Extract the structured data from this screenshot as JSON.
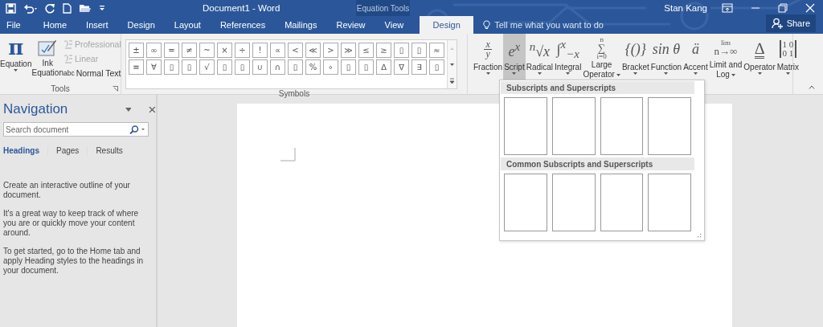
{
  "window": {
    "title": "Document1 - Word",
    "user": "Stan Kang"
  },
  "contextual_tab": {
    "label": "Equation Tools"
  },
  "tabs": [
    {
      "label": "File",
      "selected": false
    },
    {
      "label": "Home",
      "selected": false
    },
    {
      "label": "Insert",
      "selected": false
    },
    {
      "label": "Design",
      "selected": false
    },
    {
      "label": "Layout",
      "selected": false
    },
    {
      "label": "References",
      "selected": false
    },
    {
      "label": "Mailings",
      "selected": false
    },
    {
      "label": "Review",
      "selected": false
    },
    {
      "label": "View",
      "selected": false
    },
    {
      "label": "Design",
      "selected": true
    }
  ],
  "tell_me": {
    "placeholder": "Tell me what you want to do"
  },
  "share": {
    "label": "Share"
  },
  "tools_group": {
    "label": "Tools",
    "equation_glyph": "π",
    "equation": "Equation",
    "ink_equation": [
      "Ink",
      "Equation"
    ],
    "options": [
      {
        "kind": "format",
        "label": "Professional",
        "disabled": true
      },
      {
        "kind": "format",
        "label": "Linear",
        "disabled": true
      },
      {
        "kind": "text",
        "prefix": "abc",
        "label": "Normal Text",
        "disabled": false
      }
    ]
  },
  "symbols_group": {
    "label": "Symbols",
    "rows": [
      [
        "±",
        "∞",
        "=",
        "≠",
        "~",
        "×",
        "÷",
        "!",
        "∝",
        "<",
        "≪",
        ">",
        "≫",
        "≤",
        "≥",
        "▯",
        "▯",
        "≈"
      ],
      [
        "≡",
        "∀",
        "▯",
        "▯",
        "√",
        "▯",
        "▯",
        "∪",
        "∩",
        "▯",
        "%",
        "∘",
        "▯",
        "▯",
        "∆",
        "∇",
        "∃",
        "▯"
      ]
    ]
  },
  "structures": [
    {
      "kind": "fraction",
      "symbol": [
        "x",
        "y"
      ],
      "label": [
        "Fraction"
      ],
      "selected": false
    },
    {
      "kind": "inline",
      "symbol": [
        "e$^{x}$"
      ],
      "label": [
        "Script"
      ],
      "selected": true
    },
    {
      "kind": "inline",
      "symbol": [
        "$^{n}$√x"
      ],
      "label": [
        "Radical"
      ],
      "selected": false
    },
    {
      "kind": "inline",
      "symbol": [
        "∫$^{x}$$_{−x}$"
      ],
      "label": [
        "Integral"
      ],
      "selected": false
    },
    {
      "kind": "stack",
      "symbol": [
        "n",
        "∑",
        "i=0"
      ],
      "label": [
        "Large",
        "Operator"
      ],
      "selected": false
    },
    {
      "kind": "inline",
      "symbol": [
        "{()}"
      ],
      "label": [
        "Bracket"
      ],
      "selected": false
    },
    {
      "kind": "inline",
      "symbol": [
        "sin θ"
      ],
      "label": [
        "Function"
      ],
      "selected": false
    },
    {
      "kind": "inline",
      "symbol": [
        "ä"
      ],
      "label": [
        "Accent"
      ],
      "selected": false
    },
    {
      "kind": "stack",
      "symbol": [
        "lim",
        "n→∞"
      ],
      "label": [
        "Limit and",
        "Log"
      ],
      "selected": false
    },
    {
      "kind": "operator",
      "symbol": [
        "∆"
      ],
      "label": [
        "Operator"
      ],
      "selected": false
    },
    {
      "kind": "matrix",
      "symbol": [
        "1 0",
        "0 1"
      ],
      "label": [
        "Matrix"
      ],
      "selected": false
    }
  ],
  "navigation": {
    "title": "Navigation",
    "search": {
      "placeholder": "Search document"
    },
    "tabs": [
      {
        "label": "Headings",
        "selected": true
      },
      {
        "label": "Pages",
        "selected": false
      },
      {
        "label": "Results",
        "selected": false
      }
    ],
    "paragraphs": [
      "Create an interactive outline of your document.",
      "It's a great way to keep track of where you are or quickly move your content around.",
      "To get started, go to the Home tab and apply Heading styles to the headings in your document."
    ]
  },
  "script_menu": {
    "sections": [
      {
        "title": "Subscripts and Superscripts"
      },
      {
        "title": "Common Subscripts and Superscripts"
      }
    ]
  }
}
